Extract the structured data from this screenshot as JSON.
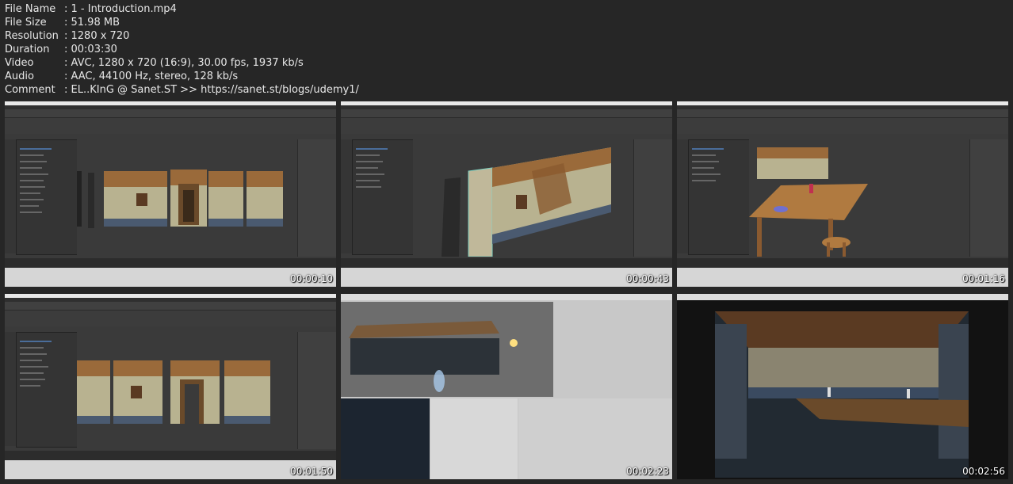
{
  "info": {
    "rows": [
      {
        "key": "File Name",
        "value": ":  1 - Introduction.mp4"
      },
      {
        "key": "File Size",
        "value": ":  51.98 MB"
      },
      {
        "key": "Resolution",
        "value": ":  1280 x 720"
      },
      {
        "key": "Duration",
        "value": ":  00:03:30"
      },
      {
        "key": "Video",
        "value": ":  AVC, 1280 x 720 (16:9), 30.00 fps, 1937 kb/s"
      },
      {
        "key": "Audio",
        "value": ":  AAC, 44100 Hz, stereo, 128 kb/s"
      },
      {
        "key": "Comment",
        "value": ":  EL..KInG @ Sanet.ST >> https://sanet.st/blogs/udemy1/"
      }
    ]
  },
  "thumbnails": [
    {
      "timestamp": "00:00:10",
      "scene": "3ds Max - modular wall pieces"
    },
    {
      "timestamp": "00:00:43",
      "scene": "3ds Max - wall perspective"
    },
    {
      "timestamp": "00:01:16",
      "scene": "3ds Max - table and stool"
    },
    {
      "timestamp": "00:01:50",
      "scene": "3ds Max - wall with door frame"
    },
    {
      "timestamp": "00:02:23",
      "scene": "Unity - scene editor"
    },
    {
      "timestamp": "00:02:56",
      "scene": "Unity - tavern interior"
    }
  ],
  "colors": {
    "background": "#262626",
    "text": "#e6e6e6",
    "max_ui": "#3a3a3a",
    "wood": "#9a6a3a",
    "plaster": "#b8b290",
    "stone": "#4a5a70"
  }
}
